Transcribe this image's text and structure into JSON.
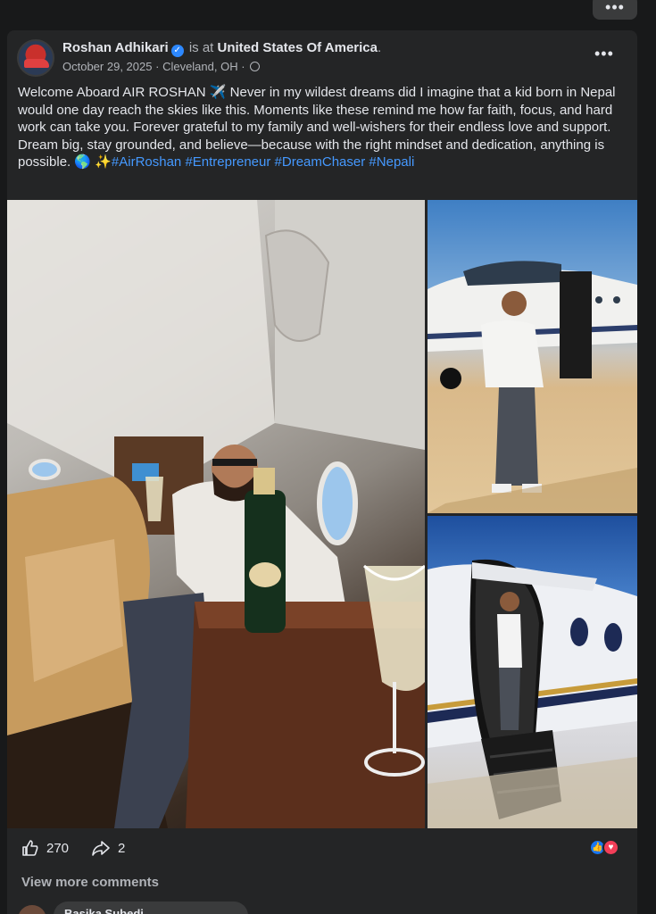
{
  "post": {
    "author": "Roshan Adhikari",
    "is_at": "is at",
    "location_name": "United States Of America",
    "location_period": ".",
    "date": "October 29, 2025",
    "separator": "·",
    "city": "Cleveland, OH",
    "body": "Welcome Aboard AIR ROSHAN ✈️ Never in my wildest dreams did I imagine that a kid born in Nepal would one day reach the skies like this. Moments like these remind me how far faith, focus, and hard work can take you. Forever grateful to my family and well-wishers for their endless love and support. Dream big, stay grounded, and believe—because with the right mindset and dedication, anything is possible. 🌎 ✨",
    "hashtags": [
      "#AirRoshan",
      "#Entrepreneur",
      "#DreamChaser",
      "#Nepali"
    ]
  },
  "reactions": {
    "likes": "270",
    "shares": "2"
  },
  "comments": {
    "view_more": "View more comments",
    "first_commenter": "Basika Subedi"
  },
  "icons": {
    "top_more": "more-horizontal-icon",
    "post_more": "more-horizontal-icon",
    "verified": "verified-badge-icon",
    "privacy": "globe-icon",
    "like": "thumbs-up-icon",
    "share": "share-arrow-icon",
    "reaction_like": "like-reaction-icon",
    "reaction_love": "love-reaction-icon"
  },
  "colors": {
    "background": "#18191a",
    "card": "#242526",
    "accent": "#4599ff",
    "like_blue": "#1877f2",
    "love_red": "#f33e58"
  }
}
